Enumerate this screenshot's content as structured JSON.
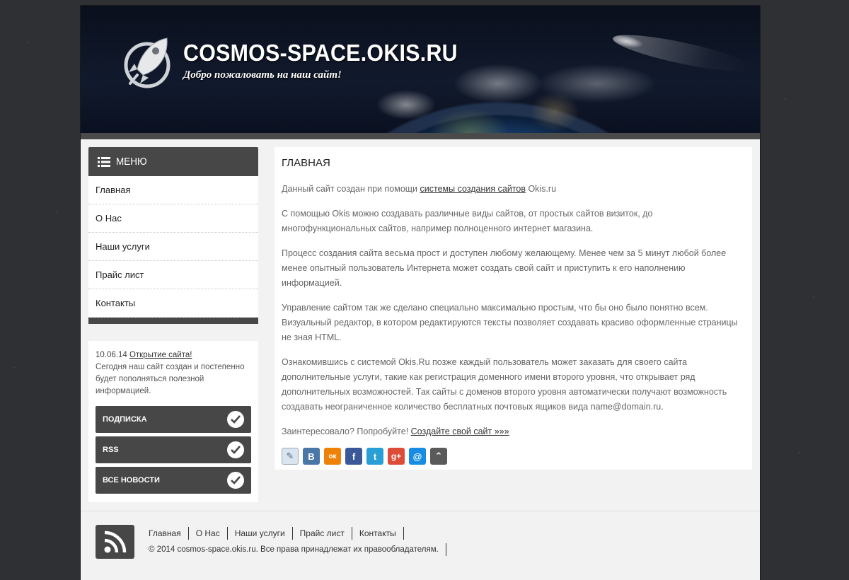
{
  "header": {
    "title": "COSMOS-SPACE.OKIS.RU",
    "slogan": "Добро пожаловать на наш сайт!"
  },
  "menu": {
    "title": "МЕНЮ",
    "items": [
      "Главная",
      "О Нас",
      "Наши услуги",
      "Прайс лист",
      "Контакты"
    ]
  },
  "news": {
    "date": "10.06.14",
    "link": "Открытие сайта!",
    "text": "Сегодня наш сайт создан и постепенно будет пополняться полезной информацией.",
    "buttons": [
      "ПОДПИСКА",
      "RSS",
      "ВСЕ НОВОСТИ"
    ]
  },
  "content": {
    "heading": "ГЛАВНАЯ",
    "p1_before": "Данный сайт создан при помощи ",
    "p1_link": "системы создания сайтов",
    "p1_after": " Okis.ru",
    "p2": "С помощью Okis можно создавать различные виды сайтов, от простых сайтов визиток, до многофункциональных сайтов, например полноценного интернет магазина.",
    "p3": "Процесс создания сайта весьма прост и доступен любому желающему. Менее чем за 5 минут любой более менее опытный пользователь Интернета может создать свой сайт и приступить к его наполнению информацией.",
    "p4": "Управление сайтом так же сделано специально максимально простым, что бы оно было понятно всем. Визуальный редактор, в котором редактируются тексты позволяет создавать красиво оформленные страницы не зная HTML.",
    "p5": "Ознакомившись с системой Okis.Ru позже каждый пользователь может заказать для своего сайта дополнительные услуги, такие как регистрация доменного имени второго уровня, что открывает ряд дополнительных возможностей. Так сайты с доменов второго уровня автоматически получают возможность создавать неограниченное количество бесплатных почтовых ящиков вида name@domain.ru.",
    "p6_before": "Заинтересовало? Попробуйте! ",
    "p6_link": "Создайте свой сайт »»»",
    "share": [
      {
        "icon": "livejournal-icon",
        "glyph": "✎",
        "color": "#d9e4ee"
      },
      {
        "icon": "vk-icon",
        "glyph": "В",
        "color": "#4b76a8"
      },
      {
        "icon": "odnoklassniki-icon",
        "glyph": "ок",
        "color": "#ee8208"
      },
      {
        "icon": "facebook-icon",
        "glyph": "f",
        "color": "#3b5998"
      },
      {
        "icon": "twitter-icon",
        "glyph": "t",
        "color": "#2a9fd6"
      },
      {
        "icon": "google-plus-icon",
        "glyph": "g+",
        "color": "#dd4b39"
      },
      {
        "icon": "mailru-icon",
        "glyph": "@",
        "color": "#168de2"
      },
      {
        "icon": "more-share-icon",
        "glyph": "⌃",
        "color": "#5a5a5a"
      }
    ]
  },
  "footer": {
    "links": [
      "Главная",
      "О Нас",
      "Наши услуги",
      "Прайс лист",
      "Контакты"
    ],
    "copyright": "© 2014 cosmos-space.okis.ru. Все права принадлежат их правообладателям."
  }
}
